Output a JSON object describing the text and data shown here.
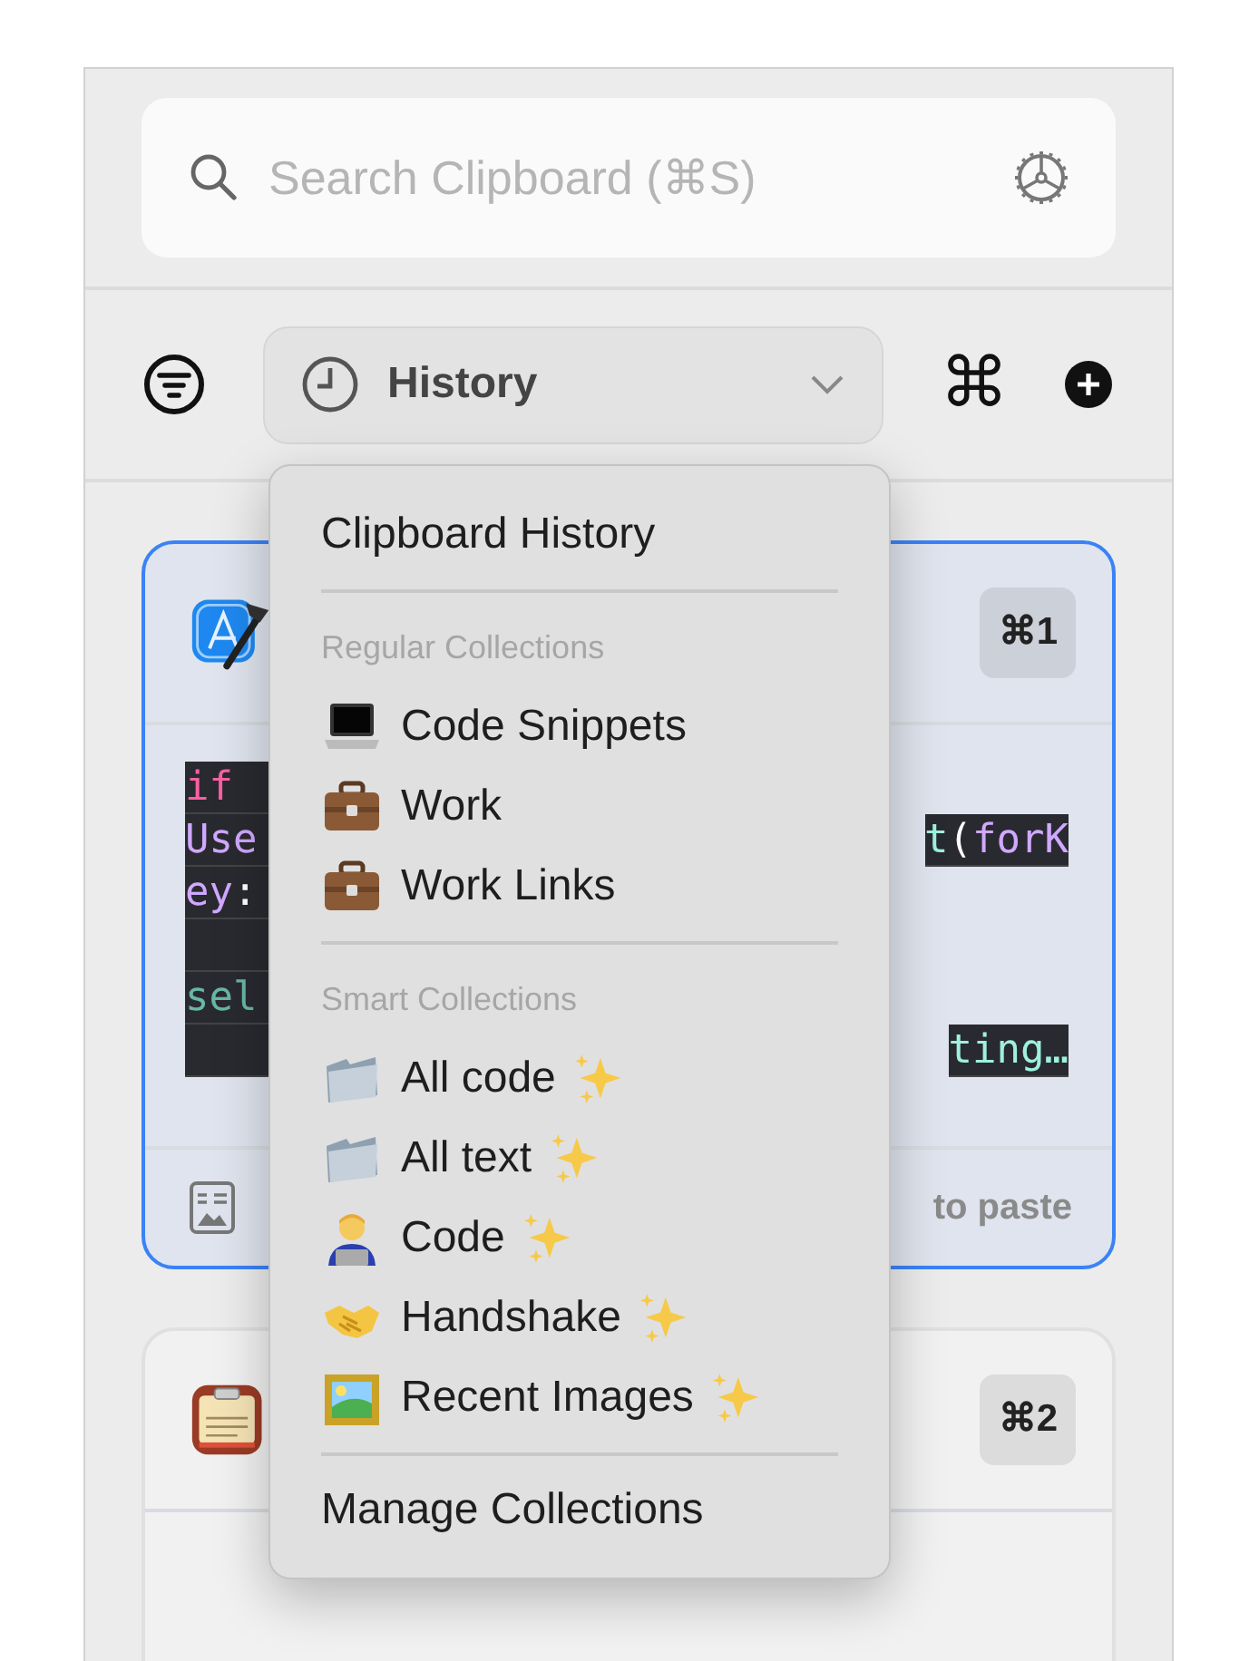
{
  "search": {
    "placeholder": "Search Clipboard (⌘S)"
  },
  "toolbar": {
    "collection_button": {
      "label": "History"
    },
    "shortcut_glyph": "⌘"
  },
  "menu": {
    "items": [
      {
        "kind": "item",
        "label": "Clipboard History"
      },
      {
        "kind": "divider"
      },
      {
        "kind": "header",
        "label": "Regular Collections"
      },
      {
        "kind": "collection",
        "label": "Code Snippets",
        "smart": false
      },
      {
        "kind": "collection",
        "label": "Work",
        "smart": false
      },
      {
        "kind": "collection",
        "label": "Work Links",
        "smart": false
      },
      {
        "kind": "divider"
      },
      {
        "kind": "header",
        "label": "Smart Collections"
      },
      {
        "kind": "collection",
        "label": "All code",
        "smart": true
      },
      {
        "kind": "collection",
        "label": "All text",
        "smart": true
      },
      {
        "kind": "collection",
        "label": "Code",
        "smart": true
      },
      {
        "kind": "collection",
        "label": "Handshake",
        "smart": true
      },
      {
        "kind": "collection",
        "label": "Recent Images",
        "smart": true
      },
      {
        "kind": "divider"
      },
      {
        "kind": "item",
        "label": "Manage Collections"
      }
    ]
  },
  "clips": [
    {
      "selected": true,
      "shortcut": "⌘1",
      "code_lines": [
        {
          "kind": "code",
          "start": [
            {
              "text": "if",
              "color": "#fc5fa3"
            }
          ]
        },
        {
          "kind": "code",
          "start": [
            {
              "text": "Use",
              "color": "#d0a8ff"
            }
          ],
          "end": [
            {
              "text": "t",
              "color": "#9ef1dd"
            },
            {
              "text": "(",
              "color": "#ffffff"
            },
            {
              "text": "forK",
              "color": "#d0a8ff"
            }
          ]
        },
        {
          "kind": "code",
          "start": [
            {
              "text": "ey",
              "color": "#d0a8ff"
            },
            {
              "text": ":",
              "color": "#ffffff"
            }
          ]
        },
        {
          "kind": "blank"
        },
        {
          "kind": "code",
          "start": [
            {
              "text": "sel",
              "color": "#67b7a4"
            }
          ]
        },
        {
          "kind": "code",
          "end": [
            {
              "text": "ting…",
              "color": "#9ef1dd"
            }
          ]
        }
      ],
      "footer": "to paste"
    },
    {
      "selected": false,
      "shortcut": "⌘2"
    }
  ]
}
